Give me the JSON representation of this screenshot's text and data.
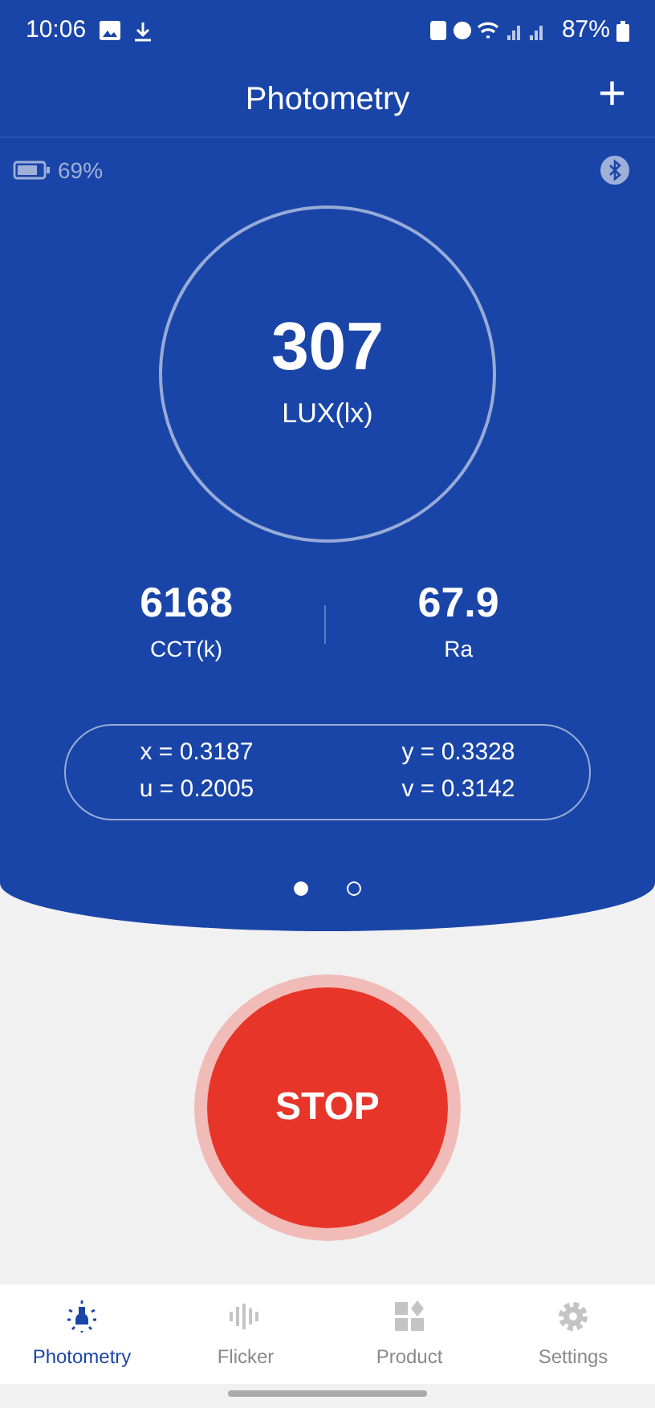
{
  "status_bar": {
    "time": "10:06",
    "battery": "87%"
  },
  "header": {
    "title": "Photometry",
    "action": "+"
  },
  "device": {
    "battery": "69%",
    "bluetooth_connected": false
  },
  "main_reading": {
    "value": "307",
    "unit": "LUX(lx)"
  },
  "stats": [
    {
      "value": "6168",
      "label": "CCT(k)"
    },
    {
      "value": "67.9",
      "label": "Ra"
    }
  ],
  "coordinates": [
    "x = 0.3187",
    "y = 0.3328",
    "u = 0.2005",
    "v = 0.3142"
  ],
  "pages": [
    {
      "selected": true
    },
    {
      "selected": false
    }
  ],
  "stop_button": {
    "label": "STOP"
  },
  "nav": [
    {
      "label": "Photometry",
      "kind": "bulb",
      "selected": true
    },
    {
      "label": "Flicker",
      "kind": "wave",
      "selected": false
    },
    {
      "label": "Product",
      "kind": "grid",
      "selected": false
    },
    {
      "label": "Settings",
      "kind": "gear",
      "selected": false
    }
  ]
}
